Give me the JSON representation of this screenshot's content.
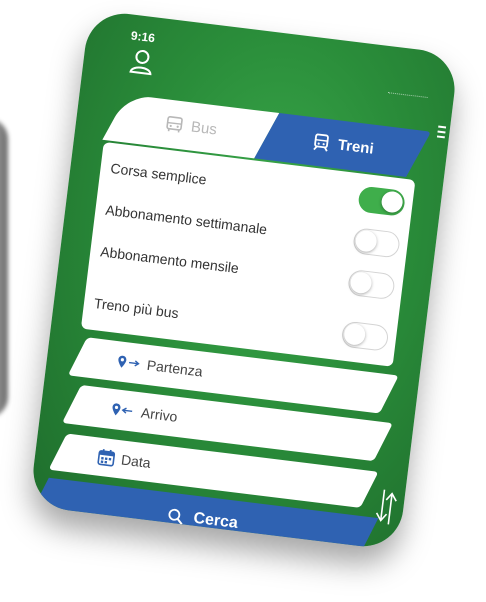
{
  "status_bar": {
    "time": "9:16"
  },
  "tabs": [
    {
      "label": "Bus",
      "active": false,
      "icon": "bus-icon"
    },
    {
      "label": "Treni",
      "active": true,
      "icon": "train-icon"
    }
  ],
  "options": [
    {
      "label": "Corsa semplice",
      "enabled": true
    },
    {
      "label": "Abbonamento settimanale",
      "enabled": false
    },
    {
      "label": "Abbonamento mensile",
      "enabled": false
    },
    {
      "label": "Treno più bus",
      "enabled": false
    }
  ],
  "fields": {
    "departure": {
      "label": "Partenza",
      "icon": "pin-arrow-right-icon"
    },
    "arrival": {
      "label": "Arrivo",
      "icon": "pin-arrow-left-icon"
    },
    "date": {
      "label": "Data",
      "icon": "calendar-icon"
    }
  },
  "search_button": {
    "label": "Cerca",
    "icon": "search-icon"
  },
  "colors": {
    "background_green": "#2a8d3a",
    "accent_blue": "#2f62b2",
    "toggle_on": "#3fae4b"
  }
}
